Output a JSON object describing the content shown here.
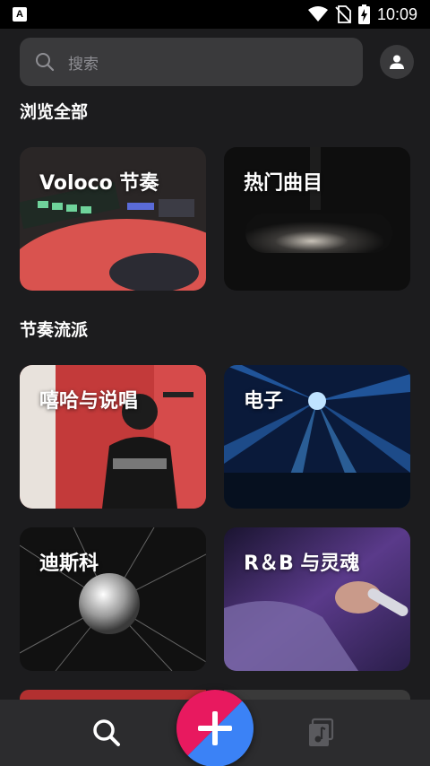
{
  "status": {
    "time": "10:09",
    "badge": "A"
  },
  "search": {
    "placeholder": "搜索"
  },
  "sections": {
    "browse_all": "浏览全部",
    "genres": "节奏流派"
  },
  "cards": {
    "voloco_beats": "Voloco 节奏",
    "top_tracks": "热门曲目",
    "hiphop_rap": "嘻哈与说唱",
    "electronic": "电子",
    "disco": "迪斯科",
    "rnb_soul": "R＆B 与灵魂"
  },
  "icons": {
    "search": "search-icon",
    "profile": "person-icon",
    "add": "plus-icon",
    "library": "music-library-icon"
  },
  "colors": {
    "background": "#1c1c1e",
    "fab_pink": "#e8195f",
    "fab_blue": "#3b82f6"
  }
}
